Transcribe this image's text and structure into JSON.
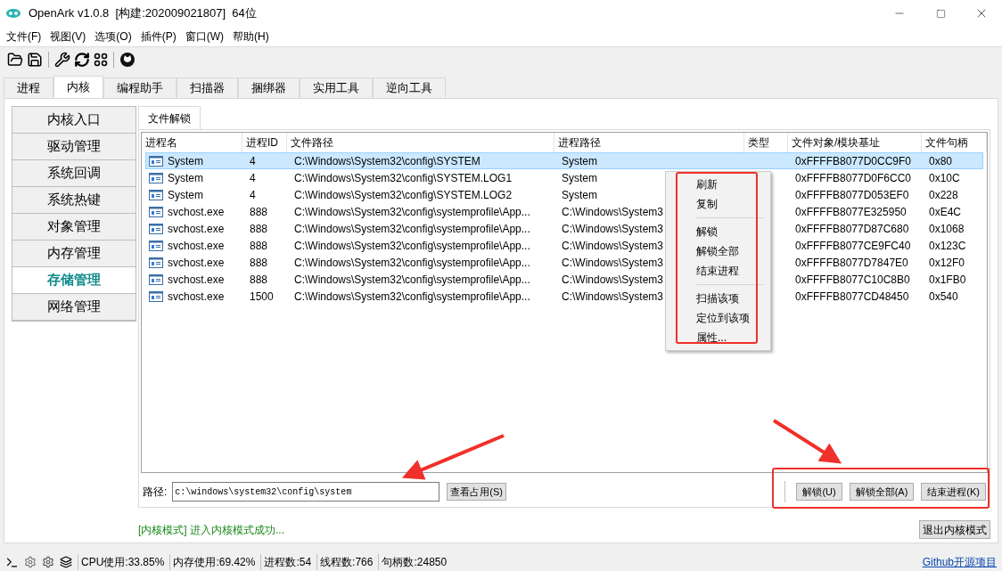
{
  "window": {
    "title": "OpenArk v1.0.8  [构建:202009021807]  64位"
  },
  "menu": [
    "文件(F)",
    "视图(V)",
    "选项(O)",
    "插件(P)",
    "窗口(W)",
    "帮助(H)"
  ],
  "tabs": [
    {
      "label": "进程",
      "selected": false
    },
    {
      "label": "内核",
      "selected": true
    },
    {
      "label": "编程助手",
      "selected": false
    },
    {
      "label": "扫描器",
      "selected": false
    },
    {
      "label": "捆绑器",
      "selected": false
    },
    {
      "label": "实用工具",
      "selected": false
    },
    {
      "label": "逆向工具",
      "selected": false
    }
  ],
  "sidebar": {
    "items": [
      {
        "label": "内核入口",
        "selected": false
      },
      {
        "label": "驱动管理",
        "selected": false
      },
      {
        "label": "系统回调",
        "selected": false
      },
      {
        "label": "系统热键",
        "selected": false
      },
      {
        "label": "对象管理",
        "selected": false
      },
      {
        "label": "内存管理",
        "selected": false
      },
      {
        "label": "存储管理",
        "selected": true
      },
      {
        "label": "网络管理",
        "selected": false
      }
    ]
  },
  "subtab": {
    "label": "文件解锁",
    "selected": true
  },
  "table": {
    "columns": [
      "进程名",
      "进程ID",
      "文件路径",
      "进程路径",
      "类型",
      "文件对象/模块基址",
      "文件句柄"
    ],
    "rows": [
      {
        "selected": true,
        "name": "System",
        "pid": "4",
        "file": "C:\\Windows\\System32\\config\\SYSTEM",
        "proc": "System",
        "obj": "0xFFFFB8077D0CC9F0",
        "handle": "0x80"
      },
      {
        "selected": false,
        "name": "System",
        "pid": "4",
        "file": "C:\\Windows\\System32\\config\\SYSTEM.LOG1",
        "proc": "System",
        "obj": "0xFFFFB8077D0F6CC0",
        "handle": "0x10C"
      },
      {
        "selected": false,
        "name": "System",
        "pid": "4",
        "file": "C:\\Windows\\System32\\config\\SYSTEM.LOG2",
        "proc": "System",
        "obj": "0xFFFFB8077D053EF0",
        "handle": "0x228"
      },
      {
        "selected": false,
        "name": "svchost.exe",
        "pid": "888",
        "file": "C:\\Windows\\System32\\config\\systemprofile\\App...",
        "proc": "C:\\Windows\\System3",
        "obj": "0xFFFFB8077E325950",
        "handle": "0xE4C"
      },
      {
        "selected": false,
        "name": "svchost.exe",
        "pid": "888",
        "file": "C:\\Windows\\System32\\config\\systemprofile\\App...",
        "proc": "C:\\Windows\\System3",
        "obj": "0xFFFFB8077D87C680",
        "handle": "0x1068"
      },
      {
        "selected": false,
        "name": "svchost.exe",
        "pid": "888",
        "file": "C:\\Windows\\System32\\config\\systemprofile\\App...",
        "proc": "C:\\Windows\\System3",
        "obj": "0xFFFFB8077CE9FC40",
        "handle": "0x123C"
      },
      {
        "selected": false,
        "name": "svchost.exe",
        "pid": "888",
        "file": "C:\\Windows\\System32\\config\\systemprofile\\App...",
        "proc": "C:\\Windows\\System3",
        "obj": "0xFFFFB8077D7847E0",
        "handle": "0x12F0"
      },
      {
        "selected": false,
        "name": "svchost.exe",
        "pid": "888",
        "file": "C:\\Windows\\System32\\config\\systemprofile\\App...",
        "proc": "C:\\Windows\\System3",
        "obj": "0xFFFFB8077C10C8B0",
        "handle": "0x1FB0"
      },
      {
        "selected": false,
        "name": "svchost.exe",
        "pid": "1500",
        "file": "C:\\Windows\\System32\\config\\systemprofile\\App...",
        "proc": "C:\\Windows\\System3",
        "obj": "0xFFFFB8077CD48450",
        "handle": "0x540"
      }
    ]
  },
  "context_menu": [
    {
      "kind": "item",
      "label": "刷新"
    },
    {
      "kind": "item",
      "label": "复制"
    },
    {
      "kind": "separator"
    },
    {
      "kind": "item",
      "label": "解锁"
    },
    {
      "kind": "item",
      "label": "解锁全部"
    },
    {
      "kind": "item",
      "label": "结束进程"
    },
    {
      "kind": "separator"
    },
    {
      "kind": "item",
      "label": "扫描该项"
    },
    {
      "kind": "item",
      "label": "定位到该项"
    },
    {
      "kind": "item",
      "label": "属性..."
    }
  ],
  "path": {
    "label": "路径:",
    "value": "c:\\windows\\system32\\config\\system",
    "button": "查看占用(S)"
  },
  "actions": [
    "解锁(U)",
    "解锁全部(A)",
    "结束进程(K)"
  ],
  "message": "[内核模式] 进入内核模式成功...",
  "exit_button": "退出内核模式",
  "status_bar": {
    "items": [
      "CPU使用:33.85%",
      "内存使用:69.42%",
      "进程数:54",
      "线程数:766",
      "句柄数:24850"
    ],
    "link": "Github开源项目"
  }
}
